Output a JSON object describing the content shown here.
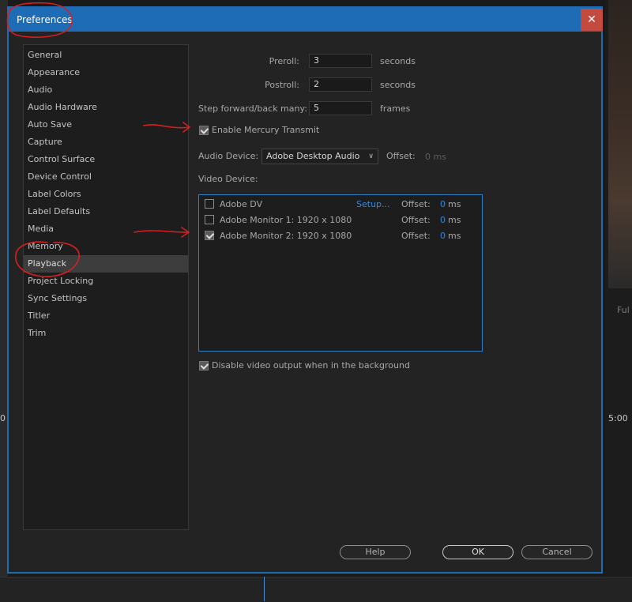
{
  "dialog": {
    "title": "Preferences",
    "close_glyph": "✕"
  },
  "sidebar": {
    "items": [
      {
        "label": "General"
      },
      {
        "label": "Appearance"
      },
      {
        "label": "Audio"
      },
      {
        "label": "Audio Hardware"
      },
      {
        "label": "Auto Save"
      },
      {
        "label": "Capture"
      },
      {
        "label": "Control Surface"
      },
      {
        "label": "Device Control"
      },
      {
        "label": "Label Colors"
      },
      {
        "label": "Label Defaults"
      },
      {
        "label": "Media"
      },
      {
        "label": "Memory"
      },
      {
        "label": "Playback",
        "selected": true
      },
      {
        "label": "Project Locking"
      },
      {
        "label": "Sync Settings"
      },
      {
        "label": "Titler"
      },
      {
        "label": "Trim"
      }
    ]
  },
  "playback": {
    "preroll": {
      "label": "Preroll:",
      "value": "3",
      "unit": "seconds"
    },
    "postroll": {
      "label": "Postroll:",
      "value": "2",
      "unit": "seconds"
    },
    "step": {
      "label": "Step forward/back many:",
      "value": "5",
      "unit": "frames"
    },
    "mercury": {
      "label": "Enable Mercury Transmit",
      "checked": true
    },
    "audio_device": {
      "label": "Audio Device:",
      "value": "Adobe Desktop Audio",
      "offset_label": "Offset:",
      "offset_value": "0 ms"
    },
    "video_device_label": "Video Device:",
    "video_devices": [
      {
        "name": "Adobe DV",
        "checked": false,
        "setup": "Setup...",
        "offset_label": "Offset:",
        "offset_value": "0",
        "offset_unit": "ms"
      },
      {
        "name": "Adobe Monitor 1: 1920 x 1080",
        "checked": false,
        "offset_label": "Offset:",
        "offset_value": "0",
        "offset_unit": "ms"
      },
      {
        "name": "Adobe Monitor 2: 1920 x 1080",
        "checked": true,
        "offset_label": "Offset:",
        "offset_value": "0",
        "offset_unit": "ms"
      }
    ],
    "disable_bg": {
      "label": "Disable video output when in the background",
      "checked": true
    }
  },
  "buttons": {
    "help": "Help",
    "ok": "OK",
    "cancel": "Cancel"
  },
  "background": {
    "full_label": "Ful",
    "timecode_right": "5:00",
    "timecode_left": "0"
  },
  "colors": {
    "accent": "#1e6cb5",
    "annotation": "#d42020",
    "link": "#3d86d8"
  }
}
